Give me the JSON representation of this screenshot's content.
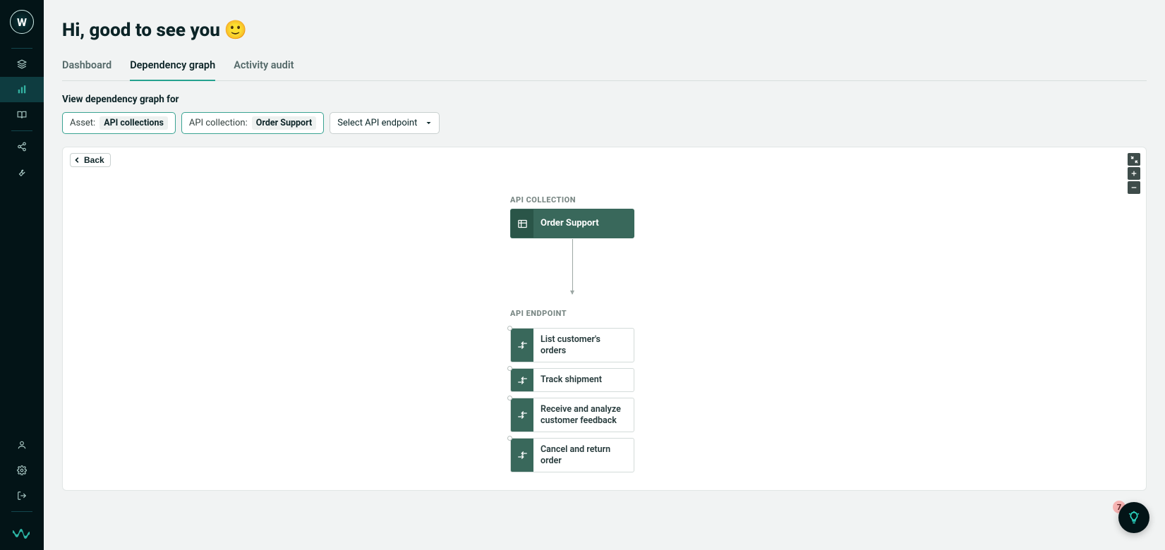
{
  "header": {
    "title_text": "Hi, good to see you",
    "title_emoji": "🙂"
  },
  "tabs": [
    {
      "id": "dashboard",
      "label": "Dashboard",
      "active": false
    },
    {
      "id": "dependency-graph",
      "label": "Dependency graph",
      "active": true
    },
    {
      "id": "activity-audit",
      "label": "Activity audit",
      "active": false
    }
  ],
  "filter_section_label": "View dependency graph for",
  "filters": {
    "asset": {
      "label": "Asset:",
      "value": "API collections"
    },
    "collection": {
      "label": "API collection:",
      "value": "Order Support"
    },
    "endpoint_button": "Select API endpoint"
  },
  "canvas": {
    "back_label": "Back",
    "section_collection_label": "API COLLECTION",
    "section_endpoint_label": "API ENDPOINT",
    "collection_node": {
      "label": "Order Support"
    },
    "endpoints": [
      {
        "label": "List customer's orders"
      },
      {
        "label": "Track shipment"
      },
      {
        "label": "Receive and analyze customer feedback"
      },
      {
        "label": "Cancel and return order"
      }
    ]
  },
  "help": {
    "badge_count": "7"
  },
  "logo_letter": "W"
}
